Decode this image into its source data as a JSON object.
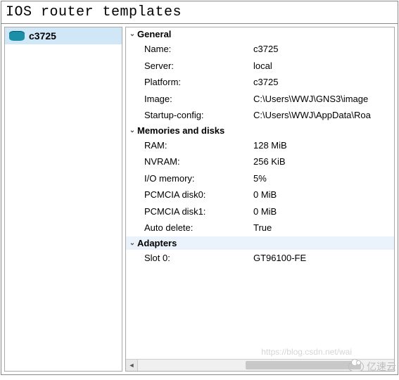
{
  "window": {
    "title": "IOS router templates"
  },
  "sidebar": {
    "items": [
      {
        "label": "c3725",
        "icon": "router-icon",
        "selected": true
      }
    ]
  },
  "details": {
    "sections": [
      {
        "title": "General",
        "expanded": true,
        "highlighted": false,
        "rows": [
          {
            "key": "Name:",
            "value": "c3725"
          },
          {
            "key": "Server:",
            "value": "local"
          },
          {
            "key": "Platform:",
            "value": "c3725"
          },
          {
            "key": "Image:",
            "value": "C:\\Users\\WWJ\\GNS3\\image"
          },
          {
            "key": "Startup-config:",
            "value": "C:\\Users\\WWJ\\AppData\\Roa"
          }
        ]
      },
      {
        "title": "Memories and disks",
        "expanded": true,
        "highlighted": false,
        "rows": [
          {
            "key": "RAM:",
            "value": "128 MiB"
          },
          {
            "key": "NVRAM:",
            "value": "256 KiB"
          },
          {
            "key": "I/O memory:",
            "value": "5%"
          },
          {
            "key": "PCMCIA disk0:",
            "value": "0 MiB"
          },
          {
            "key": "PCMCIA disk1:",
            "value": "0 MiB"
          },
          {
            "key": "Auto delete:",
            "value": "True"
          }
        ]
      },
      {
        "title": "Adapters",
        "expanded": true,
        "highlighted": true,
        "rows": [
          {
            "key": "Slot 0:",
            "value": "GT96100-FE"
          }
        ]
      }
    ]
  },
  "watermark": {
    "url": "https://blog.csdn.net/wai",
    "logo_text": "亿速云"
  }
}
